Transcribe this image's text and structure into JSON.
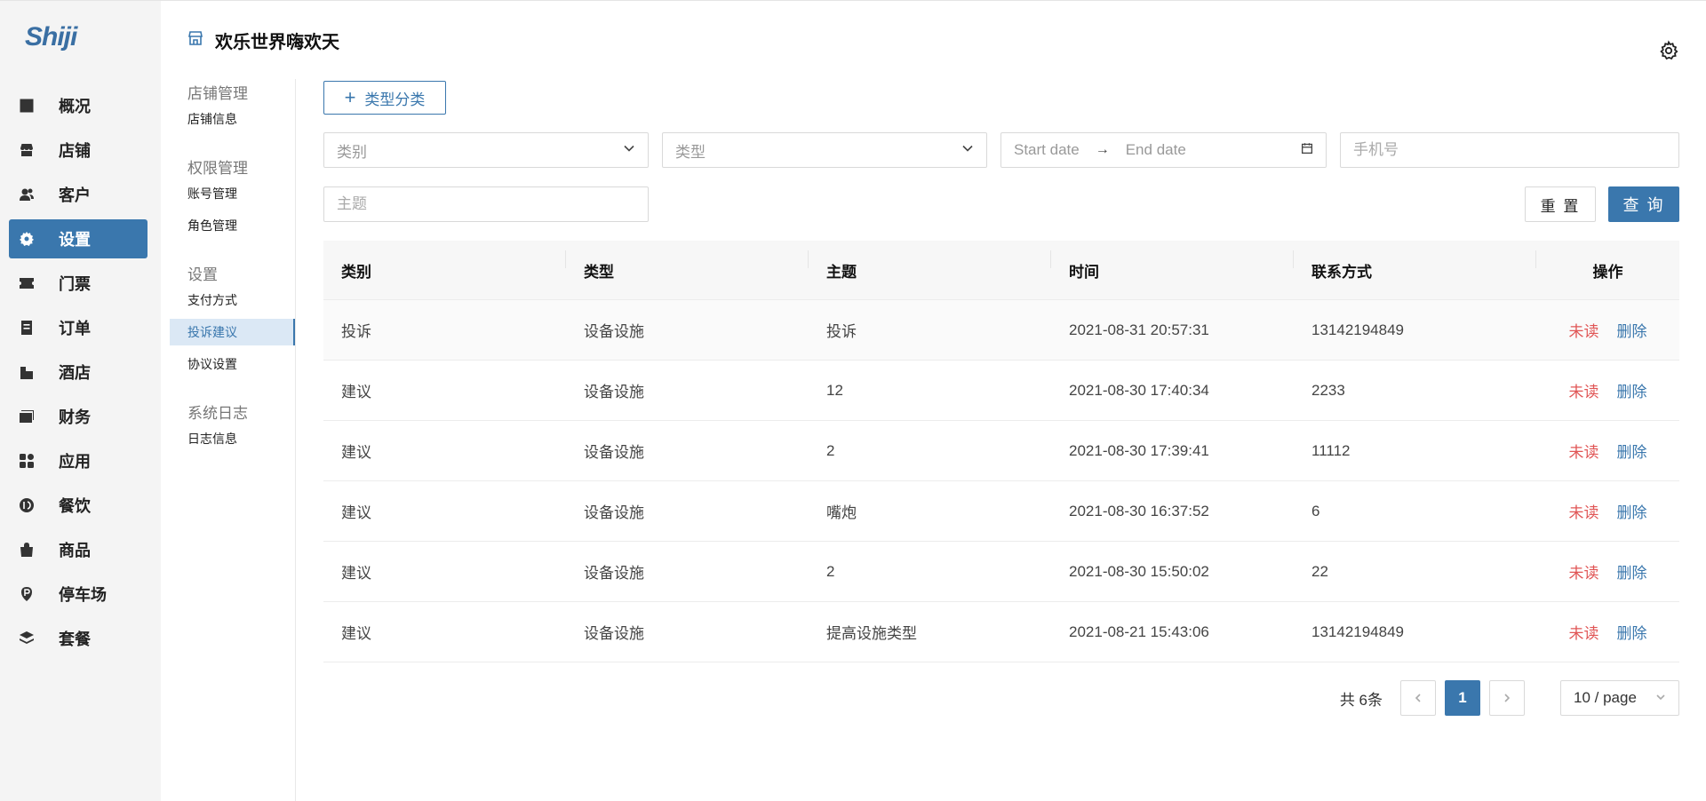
{
  "brand": {
    "logo_text": "Shiji"
  },
  "sidebar": {
    "items": [
      {
        "label": "概况",
        "icon": "chart-icon",
        "active": false
      },
      {
        "label": "店铺",
        "icon": "store-icon",
        "active": false
      },
      {
        "label": "客户",
        "icon": "users-icon",
        "active": false
      },
      {
        "label": "设置",
        "icon": "gear-icon",
        "active": true
      },
      {
        "label": "门票",
        "icon": "ticket-icon",
        "active": false
      },
      {
        "label": "订单",
        "icon": "order-icon",
        "active": false
      },
      {
        "label": "酒店",
        "icon": "hotel-icon",
        "active": false
      },
      {
        "label": "财务",
        "icon": "finance-icon",
        "active": false
      },
      {
        "label": "应用",
        "icon": "apps-icon",
        "active": false
      },
      {
        "label": "餐饮",
        "icon": "dining-icon",
        "active": false
      },
      {
        "label": "商品",
        "icon": "bag-icon",
        "active": false
      },
      {
        "label": "停车场",
        "icon": "parking-icon",
        "active": false
      },
      {
        "label": "套餐",
        "icon": "layers-icon",
        "active": false
      }
    ]
  },
  "header": {
    "store_title": "欢乐世界嗨欢天"
  },
  "submenu": {
    "groups": [
      {
        "title": "店铺管理",
        "items": [
          "店铺信息"
        ]
      },
      {
        "title": "权限管理",
        "items": [
          "账号管理",
          "角色管理"
        ]
      },
      {
        "title": "设置",
        "items": [
          "支付方式",
          "投诉建议",
          "协议设置"
        ]
      },
      {
        "title": "系统日志",
        "items": [
          "日志信息"
        ]
      }
    ],
    "active_item": "投诉建议"
  },
  "toolbar": {
    "add_label": "类型分类"
  },
  "filters": {
    "category_placeholder": "类别",
    "type_placeholder": "类型",
    "start_date_placeholder": "Start date",
    "end_date_placeholder": "End date",
    "phone_placeholder": "手机号",
    "subject_placeholder": "主题",
    "reset_label": "重 置",
    "query_label": "查 询"
  },
  "table": {
    "columns": [
      "类别",
      "类型",
      "主题",
      "时间",
      "联系方式",
      "操作"
    ],
    "rows": [
      {
        "category": "投诉",
        "type": "设备设施",
        "subject": "投诉",
        "time": "2021-08-31 20:57:31",
        "contact": "13142194849",
        "status": "未读",
        "delete": "删除"
      },
      {
        "category": "建议",
        "type": "设备设施",
        "subject": "12",
        "time": "2021-08-30 17:40:34",
        "contact": "2233",
        "status": "未读",
        "delete": "删除"
      },
      {
        "category": "建议",
        "type": "设备设施",
        "subject": "2",
        "time": "2021-08-30 17:39:41",
        "contact": "11112",
        "status": "未读",
        "delete": "删除"
      },
      {
        "category": "建议",
        "type": "设备设施",
        "subject": "嘴炮",
        "time": "2021-08-30 16:37:52",
        "contact": "6",
        "status": "未读",
        "delete": "删除"
      },
      {
        "category": "建议",
        "type": "设备设施",
        "subject": "2",
        "time": "2021-08-30 15:50:02",
        "contact": "22",
        "status": "未读",
        "delete": "删除"
      },
      {
        "category": "建议",
        "type": "设备设施",
        "subject": "提高设施类型",
        "time": "2021-08-21 15:43:06",
        "contact": "13142194849",
        "status": "未读",
        "delete": "删除"
      }
    ]
  },
  "pagination": {
    "total_text": "共 6条",
    "current_page": "1",
    "page_size": "10 / page"
  },
  "colors": {
    "primary": "#3a77ad",
    "danger": "#e05555",
    "sidebar_bg": "#f4f4f4"
  }
}
